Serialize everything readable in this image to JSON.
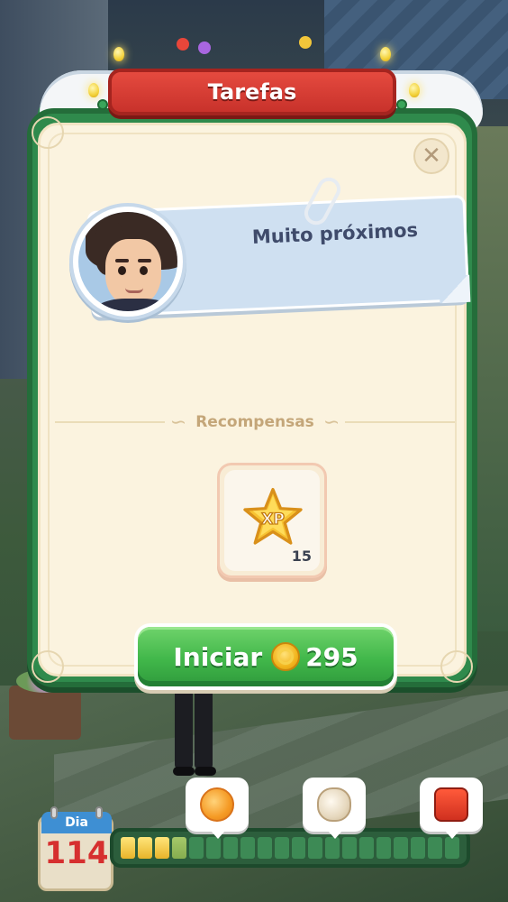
{
  "modal": {
    "title": "Tarefas",
    "close_icon": "close-icon",
    "task_text": "Muito próximos",
    "rewards_label": "Recompensas",
    "rewards": [
      {
        "icon": "xp-star-icon",
        "icon_text": "XP",
        "count": "15"
      }
    ],
    "start_button": {
      "label": "Iniciar",
      "cost_icon": "coin-icon",
      "cost": "295"
    }
  },
  "day_bar": {
    "day_label": "Dia",
    "day_number": "114",
    "segments_total": 20,
    "segments_filled": 3,
    "segments_partial": 1,
    "milestones": [
      {
        "icon": "orange-slice-icon"
      },
      {
        "icon": "seashell-icon"
      },
      {
        "icon": "red-chest-icon"
      }
    ]
  },
  "colors": {
    "frame_green": "#2f8a4c",
    "banner_red": "#d63a32",
    "panel_cream": "#fbf3df",
    "button_green": "#41b74a",
    "day_number_red": "#d62f2f"
  }
}
